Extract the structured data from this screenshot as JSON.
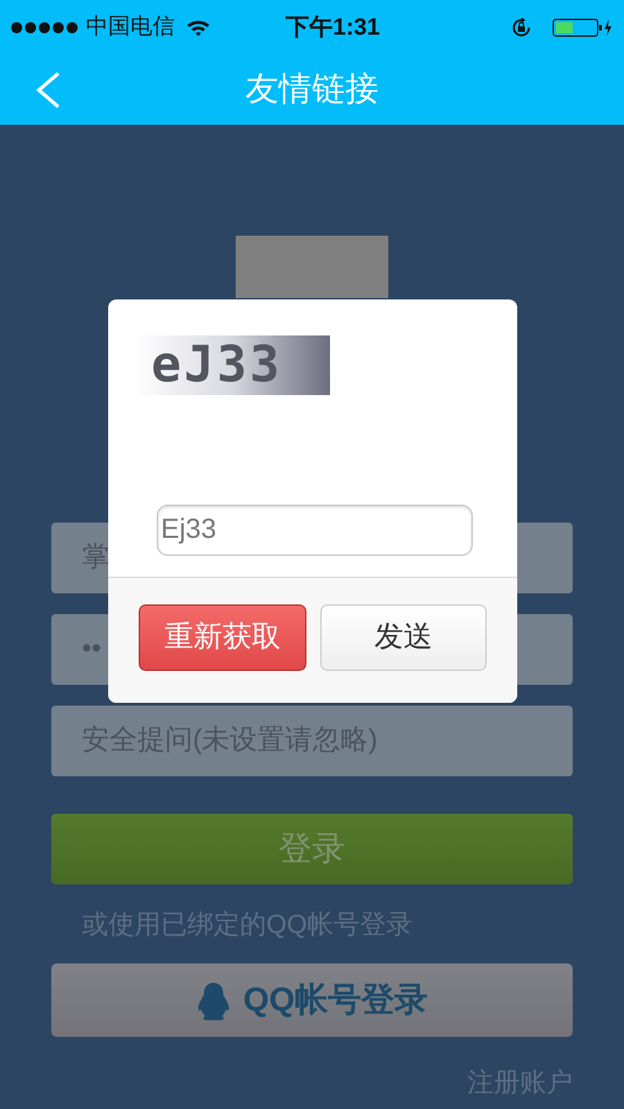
{
  "status_bar": {
    "carrier": "中国电信",
    "time": "下午1:31"
  },
  "nav_bar": {
    "title": "友情链接"
  },
  "form": {
    "fields": [
      {
        "placeholder": "掌"
      },
      {
        "value": "••"
      },
      {
        "placeholder": "安全提问(未设置请忽略)"
      }
    ],
    "login_button": "登录",
    "alt_login_text": "或使用已绑定的QQ帐号登录",
    "qq_button": "QQ帐号登录",
    "register_link": "注册账户"
  },
  "dialog": {
    "captcha": "eJ33",
    "input_value": "Ej33",
    "buttons": [
      {
        "label": "重新获取",
        "kind": "primary"
      },
      {
        "label": "发送",
        "kind": "secondary"
      }
    ]
  }
}
